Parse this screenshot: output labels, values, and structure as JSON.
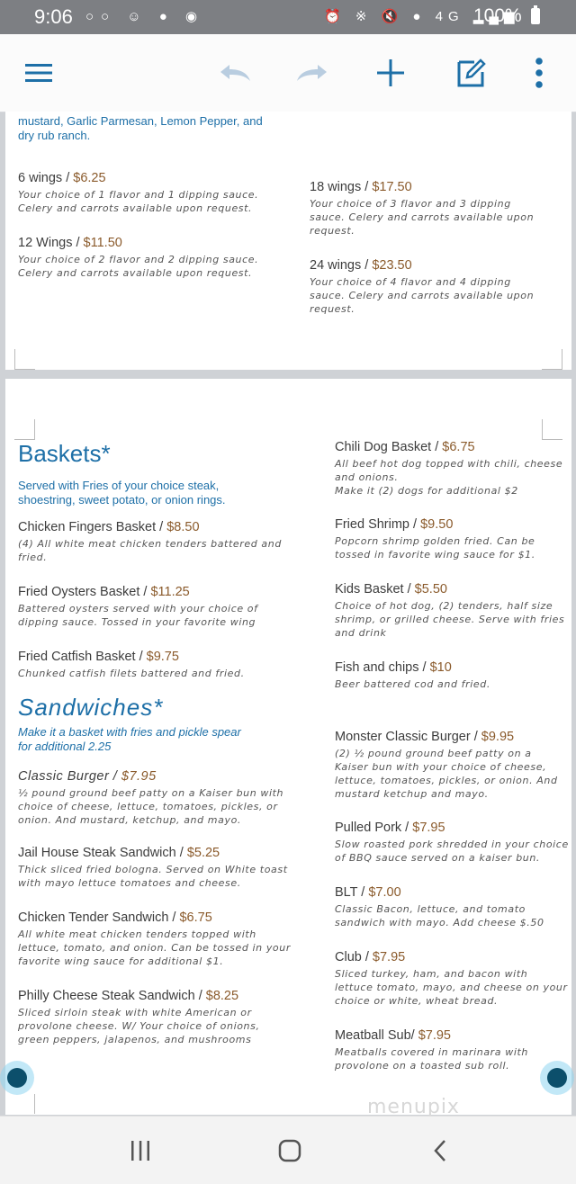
{
  "status_bar": {
    "time": "9:06",
    "battery_percent": "100%",
    "network": "4G"
  },
  "toolbar": {
    "accent_color": "#1d6fa7",
    "buttons": [
      "menu-icon",
      "undo-icon",
      "redo-icon",
      "plus-icon",
      "edit-icon",
      "more-vert-icon"
    ]
  },
  "page1": {
    "intro_text": [
      "mustard, Garlic Parmesan, Lemon Pepper, and",
      "dry rub ranch."
    ],
    "wings": [
      {
        "name": "6 wings",
        "price": "$6.25",
        "desc": [
          "Your choice of 1 flavor and 1 dipping sauce.",
          "Celery and carrots available upon request."
        ]
      },
      {
        "name": "12 Wings",
        "price": "$11.50",
        "desc": [
          "Your choice of 2 flavor and 2 dipping sauce.",
          "Celery and carrots available upon request."
        ]
      },
      {
        "name": "18 wings",
        "price": "$17.50",
        "desc": [
          "Your choice of 3 flavor and 3 dipping",
          "sauce. Celery and carrots available upon",
          "request."
        ]
      },
      {
        "name": "24 wings",
        "price": "$23.50",
        "desc": [
          "Your choice of 4 flavor and 4 dipping",
          "sauce. Celery and carrots available upon",
          "request."
        ]
      }
    ]
  },
  "baskets": {
    "title": "Baskets*",
    "subtitle": [
      "Served with Fries of your choice steak,",
      "shoestring, sweet potato, or onion rings."
    ],
    "items": [
      {
        "name": "Chicken Fingers Basket",
        "price": "$8.50",
        "desc": [
          "(4) All white meat chicken tenders battered and",
          "fried."
        ]
      },
      {
        "name": "Fried Oysters Basket",
        "price": "$11.25",
        "desc": [
          "Battered oysters served with your choice of",
          "dipping sauce. Tossed in your favorite wing"
        ]
      },
      {
        "name": "Fried Catfish Basket ",
        "price": "$9.75",
        "desc": [
          "Chunked catfish filets battered and fried."
        ]
      },
      {
        "name": "Chili Dog Basket",
        "price": "$6.75",
        "desc": [
          "All beef hot dog topped with chili, cheese",
          "and onions.",
          "Make it (2) dogs for additional $2"
        ]
      },
      {
        "name": "Fried Shrimp",
        "price": "$9.50",
        "desc": [
          "Popcorn shrimp golden fried. Can be",
          "tossed in favorite wing sauce for $1."
        ]
      },
      {
        "name": "Kids Basket",
        "price": "$5.50",
        "desc": [
          "Choice of hot dog, (2) tenders, half size",
          "shrimp, or grilled cheese. Serve with fries",
          "and drink"
        ]
      },
      {
        "name": "Fish and chips ",
        "price": "$10",
        "desc": [
          "Beer battered cod and fried."
        ]
      }
    ]
  },
  "sandwiches": {
    "title": "Sandwiches*",
    "subtitle": [
      "Make it a basket with fries and pickle spear",
      "for additional 2.25"
    ],
    "items": [
      {
        "name": "Classic Burger",
        "price": "$7.95",
        "desc": [
          " ½ pound ground beef patty on a Kaiser bun with",
          "choice of cheese, lettuce, tomatoes, pickles, or",
          "onion. And mustard, ketchup, and mayo."
        ]
      },
      {
        "name": "Jail House Steak Sandwich",
        "price": "$5.25",
        "desc": [
          "Thick sliced fried bologna. Served on White toast",
          "with mayo lettuce tomatoes and cheese."
        ]
      },
      {
        "name": "Chicken Tender Sandwich",
        "price": "$6.75",
        "desc": [
          "All white meat chicken tenders topped with",
          "lettuce, tomato, and onion. Can be tossed in your",
          "favorite wing sauce for additional $1."
        ]
      },
      {
        "name": "Philly Cheese Steak Sandwich",
        "price": "$8.25",
        "desc": [
          "Sliced sirloin steak with white American or",
          "provolone cheese. W/ Your choice of onions,",
          "green peppers, jalapenos, and mushrooms"
        ]
      },
      {
        "name": "Monster Classic Burger",
        "price": "$9.95",
        "desc": [
          " (2) ½ pound ground beef patty on a",
          "Kaiser bun with your choice of cheese,",
          "lettuce, tomatoes, pickles, or onion. And",
          "mustard ketchup and mayo."
        ]
      },
      {
        "name": "Pulled Pork",
        "price": "$7.95",
        "desc": [
          " Slow roasted pork shredded in your choice",
          "of BBQ sauce served on a kaiser bun."
        ]
      },
      {
        "name": "BLT",
        "price": "$7.00",
        "desc": [
          " Classic Bacon, lettuce, and tomato",
          "sandwich with mayo. Add cheese $.50"
        ]
      },
      {
        "name": "Club",
        "price": "$7.95",
        "desc": [
          " Sliced turkey, ham, and bacon with",
          "lettuce tomato, mayo, and cheese on your",
          "choice or white, wheat bread."
        ]
      },
      {
        "name": "Meatball Sub",
        "price": "$7.95",
        "desc": [
          " Meatballs covered in marinara with",
          "provolone on a toasted sub roll."
        ]
      }
    ]
  },
  "watermark": "menupix"
}
